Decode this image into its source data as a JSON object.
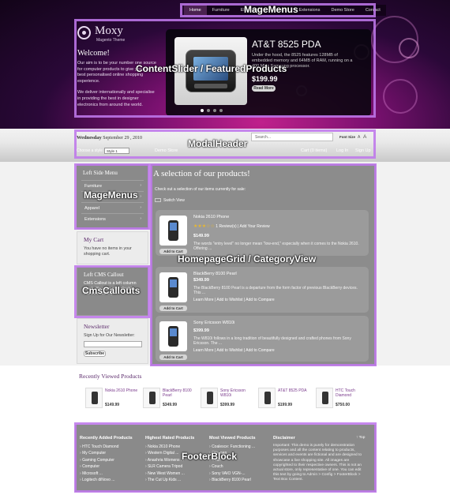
{
  "nav": {
    "items": [
      "Home",
      "Furniture",
      "Electronics",
      "Apparel",
      "Extensions",
      "Demo Store",
      "Contact"
    ],
    "active": "Home"
  },
  "logo": {
    "name": "Moxy",
    "tagline": "Magento Theme"
  },
  "welcome": {
    "title": "Welcome!",
    "p1": "Our aim is to be your number one source for computer products to give you the best personalised online shopping experience.",
    "p2": "We deliver internationally and specialise in providing the best in designer electronics from around the world."
  },
  "featured": {
    "title": "AT&T 8525 PDA",
    "desc": "Under the hood, the 8525 features 128MB of embedded memory and 64MB of RAM, running on a 400 MHz Samsung processor.",
    "price": "$199.99",
    "more_label": "Read More",
    "slides": 4
  },
  "header": {
    "day": "Wednesday",
    "date": "September 29 , 2010",
    "search_placeholder": "Search...",
    "font_size_label": "Font Size",
    "font_a_small": "A",
    "font_a_large": "A",
    "theme_label": "Choose a style",
    "theme_value": "Style 1",
    "demo_store": "Demo Store",
    "links": [
      "Cart (0 items)",
      "Log In",
      "Sign Up"
    ]
  },
  "sidebar": {
    "menu_title": "Left Side Menu",
    "menu_items": [
      "Furniture",
      "Electronics",
      "Apparel",
      "Extensions"
    ],
    "cart_title": "My Cart",
    "cart_text": "You have no items in your shopping cart.",
    "cms_title": "Left CMS Callout",
    "cms_text": "CMS Callout is a left column block. You can also disable this box entirely.",
    "news_title": "Newsletter",
    "news_label": "Sign Up for Our Newsletter:",
    "news_button": "Subscribe"
  },
  "main": {
    "title": "A selection of our products!",
    "intro": "Check out a selection of our items currently for sale:",
    "switch_view": "Switch View",
    "add_label": "Add to Cart",
    "products": [
      {
        "name": "Nokia 2610 Phone",
        "rating": "1 Review(s)",
        "add_review": "Add Your Review",
        "price": "$149.99",
        "desc": "The words \"entry level\" no longer mean \"low-end,\" especially when it comes to the Nokia 2610. Offering ...",
        "links": ""
      },
      {
        "name": "BlackBerry 8100 Pearl",
        "rating": "",
        "add_review": "",
        "price": "$349.99",
        "desc": "The BlackBerry 8100 Pearl is a departure from the form factor of previous BlackBerry devices. This ...",
        "links": "Learn More | Add to Wishlist | Add to Compare"
      },
      {
        "name": "Sony Ericsson W810i",
        "rating": "",
        "add_review": "",
        "price": "$399.99",
        "desc": "The W810i follows in a long tradition of beautifully designed and crafted phones from Sony Ericsson. The ...",
        "links": "Learn More | Add to Wishlist | Add to Compare"
      }
    ]
  },
  "recent": {
    "title": "Recently Viewed Products",
    "items": [
      {
        "name": "Nokia 2610 Phone",
        "price": "$149.99"
      },
      {
        "name": "BlackBerry 8100 Pearl",
        "price": "$349.99"
      },
      {
        "name": "Sony Ericsson W810i",
        "price": "$399.99"
      },
      {
        "name": "AT&T 8525 PDA",
        "price": "$199.99"
      },
      {
        "name": "HTC Touch Diamond",
        "price": "$750.00"
      }
    ]
  },
  "footer": {
    "col1_title": "Recently Added Products",
    "col1_items": [
      "HTC Touch Diamond",
      "My Computer",
      "Gaming Computer",
      "Computer",
      "Microsoft ...",
      "Logitech diNovo ..."
    ],
    "col2_title": "Highest Rated Products",
    "col2_items": [
      "Nokia 2610 Phone",
      "Western Digital ...",
      "Anashria Womens ...",
      "SLR Camera Tripod",
      "New West Women ...",
      "The Cut Up Kids ..."
    ],
    "col3_title": "Most Viewed Products",
    "col3_items": [
      "Coalesce: Functioning ...",
      "Ottoman",
      "Chair",
      "Couch",
      "Sony VAIO VGN-...",
      "BlackBerry 8100 Pearl"
    ],
    "disc_title": "Disclaimer",
    "disc_top": "Top",
    "disc_text": "Important: This demo is purely for demonstration purposes and all the content relating to products, services and events are fictional and are designed to showcase a live shopping site. All images are copyrighted to their respective owners. This is not an actual store, only representative of one. You can edit this text by going to Admin > Config > FooterBlock > Text Box Content."
  },
  "overlays": {
    "magemenus_top": "MageMenus",
    "content_slider": "ContentSlider / FeaturedProducts",
    "modal_header": "ModalHeader",
    "magemenus_side": "MageMenus",
    "homepage_grid": "HomepageGrid / CategoryView",
    "cms_callouts": "CmsCallouts",
    "footer_block": "FooterBlock"
  },
  "colors": {
    "overlay": "#be78eb",
    "brand": "#5b2a6b",
    "hero": "#7a1170"
  }
}
